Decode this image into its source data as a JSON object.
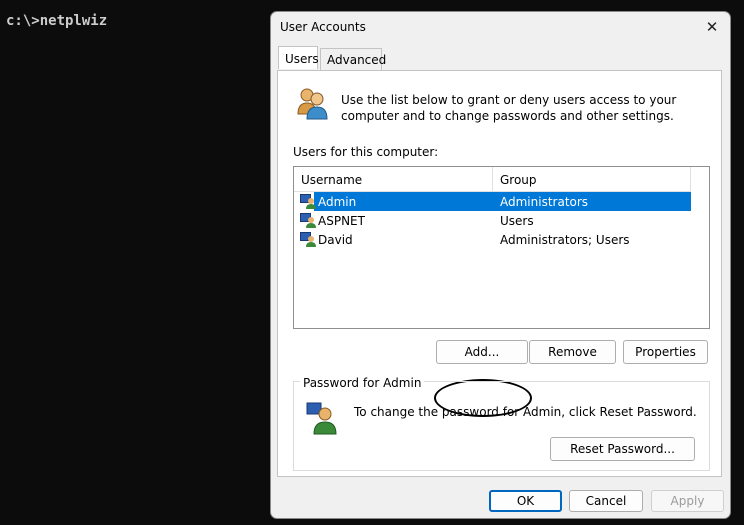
{
  "console": {
    "prompt": "c:\\>netplwiz"
  },
  "dialog": {
    "title": "User Accounts",
    "close_glyph": "✕",
    "tabs": [
      {
        "label": "Users",
        "active": true
      },
      {
        "label": "Advanced",
        "active": false
      }
    ],
    "intro_text": "Use the list below to grant or deny users access to your computer and to change passwords and other settings.",
    "users_label": "Users for this computer:",
    "list": {
      "columns": [
        "Username",
        "Group"
      ],
      "rows": [
        {
          "username": "Admin",
          "group": "Administrators",
          "selected": true
        },
        {
          "username": "ASPNET",
          "group": "Users",
          "selected": false
        },
        {
          "username": "David",
          "group": "Administrators; Users",
          "selected": false
        }
      ]
    },
    "buttons": {
      "add": "Add...",
      "remove": "Remove",
      "properties": "Properties"
    },
    "password_group": {
      "label": "Password for Admin",
      "text": "To change the password for Admin, click Reset Password.",
      "reset_button": "Reset Password..."
    },
    "footer": {
      "ok": "OK",
      "cancel": "Cancel",
      "apply": "Apply"
    }
  },
  "colors": {
    "selection": "#0078d7",
    "console_bg": "#0c0c0c",
    "console_text": "#cccccc",
    "primary_border": "#0067c0"
  },
  "icons": {
    "intro": "users-icon",
    "row": "user-icon",
    "password": "user-key-icon",
    "close": "close-icon"
  }
}
